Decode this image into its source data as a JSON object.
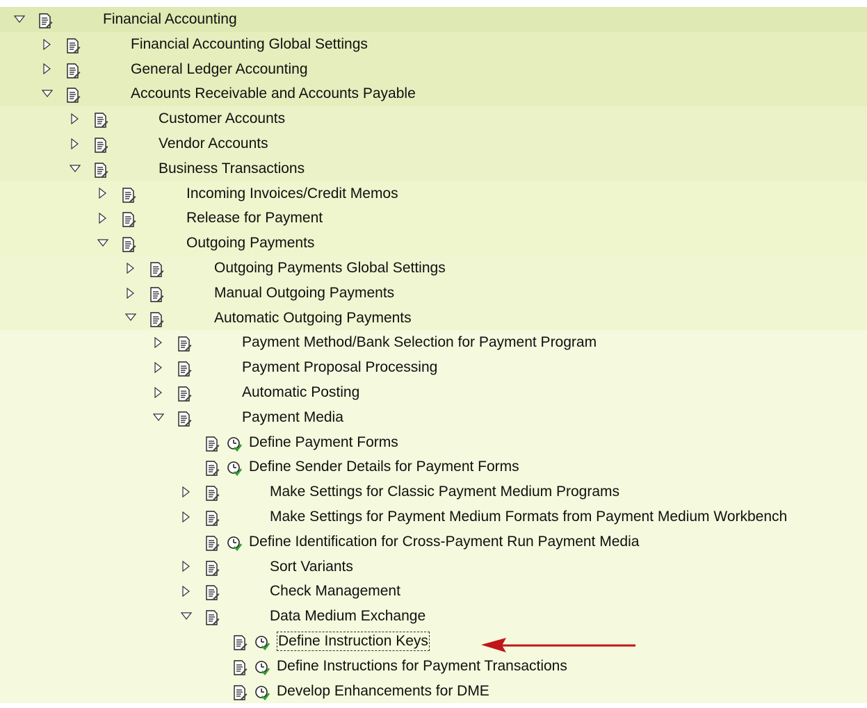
{
  "tree": [
    {
      "level": 0,
      "toggle": "expanded",
      "icon": "document-icon",
      "activity": false,
      "label": "Financial Accounting"
    },
    {
      "level": 1,
      "toggle": "collapsed",
      "icon": "document-icon",
      "activity": false,
      "label": "Financial Accounting Global Settings"
    },
    {
      "level": 1,
      "toggle": "collapsed",
      "icon": "document-icon",
      "activity": false,
      "label": "General Ledger Accounting"
    },
    {
      "level": 1,
      "toggle": "expanded",
      "icon": "document-icon",
      "activity": false,
      "label": "Accounts Receivable and Accounts Payable"
    },
    {
      "level": 2,
      "toggle": "collapsed",
      "icon": "document-icon",
      "activity": false,
      "label": "Customer Accounts"
    },
    {
      "level": 2,
      "toggle": "collapsed",
      "icon": "document-icon",
      "activity": false,
      "label": "Vendor Accounts"
    },
    {
      "level": 2,
      "toggle": "expanded",
      "icon": "document-icon",
      "activity": false,
      "label": "Business Transactions"
    },
    {
      "level": 3,
      "toggle": "collapsed",
      "icon": "document-icon",
      "activity": false,
      "label": "Incoming Invoices/Credit Memos"
    },
    {
      "level": 3,
      "toggle": "collapsed",
      "icon": "document-icon",
      "activity": false,
      "label": "Release for Payment"
    },
    {
      "level": 3,
      "toggle": "expanded",
      "icon": "document-icon",
      "activity": false,
      "label": "Outgoing Payments"
    },
    {
      "level": 4,
      "toggle": "collapsed",
      "icon": "document-icon",
      "activity": false,
      "label": "Outgoing Payments Global Settings"
    },
    {
      "level": 4,
      "toggle": "collapsed",
      "icon": "document-icon",
      "activity": false,
      "label": "Manual Outgoing Payments"
    },
    {
      "level": 4,
      "toggle": "expanded",
      "icon": "document-icon",
      "activity": false,
      "label": "Automatic Outgoing Payments"
    },
    {
      "level": 5,
      "toggle": "collapsed",
      "icon": "document-icon",
      "activity": false,
      "label": "Payment Method/Bank Selection for Payment Program"
    },
    {
      "level": 5,
      "toggle": "collapsed",
      "icon": "document-icon",
      "activity": false,
      "label": "Payment Proposal Processing"
    },
    {
      "level": 5,
      "toggle": "collapsed",
      "icon": "document-icon",
      "activity": false,
      "label": "Automatic Posting"
    },
    {
      "level": 5,
      "toggle": "expanded",
      "icon": "document-icon",
      "activity": false,
      "label": "Payment Media"
    },
    {
      "level": 6,
      "toggle": "none",
      "icon": "document-icon",
      "activity": true,
      "label": "Define Payment Forms"
    },
    {
      "level": 6,
      "toggle": "none",
      "icon": "document-icon",
      "activity": true,
      "label": "Define Sender Details for Payment Forms"
    },
    {
      "level": 6,
      "toggle": "collapsed",
      "icon": "document-icon",
      "activity": false,
      "label": "Make Settings for Classic Payment Medium Programs"
    },
    {
      "level": 6,
      "toggle": "collapsed",
      "icon": "document-icon",
      "activity": false,
      "label": "Make Settings for Payment Medium Formats from Payment Medium Workbench"
    },
    {
      "level": 6,
      "toggle": "none",
      "icon": "document-icon",
      "activity": true,
      "label": "Define Identification for Cross-Payment Run Payment Media"
    },
    {
      "level": 6,
      "toggle": "collapsed",
      "icon": "document-icon",
      "activity": false,
      "label": "Sort Variants"
    },
    {
      "level": 6,
      "toggle": "collapsed",
      "icon": "document-icon",
      "activity": false,
      "label": "Check Management"
    },
    {
      "level": 6,
      "toggle": "expanded",
      "icon": "document-icon",
      "activity": false,
      "label": "Data Medium Exchange"
    },
    {
      "level": 7,
      "toggle": "none",
      "icon": "document-icon",
      "activity": true,
      "label": "Define Instruction Keys",
      "focused": true
    },
    {
      "level": 7,
      "toggle": "none",
      "icon": "document-icon",
      "activity": true,
      "label": "Define Instructions for Payment Transactions"
    },
    {
      "level": 7,
      "toggle": "none",
      "icon": "document-icon",
      "activity": true,
      "label": "Develop Enhancements for DME"
    }
  ],
  "colors": {
    "arrow": "#c0161a",
    "check_green": "#2f9e2f"
  }
}
